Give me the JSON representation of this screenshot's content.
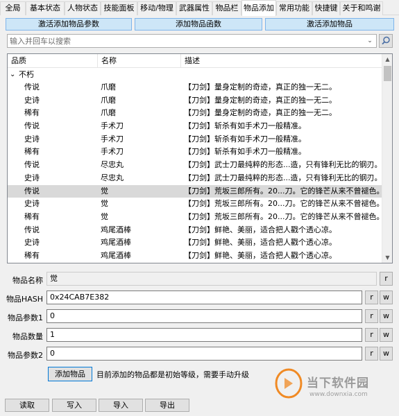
{
  "tabs": [
    {
      "label": "全局"
    },
    {
      "label": "基本状态"
    },
    {
      "label": "人物状态"
    },
    {
      "label": "技能面板"
    },
    {
      "label": "移动/物理"
    },
    {
      "label": "武器属性"
    },
    {
      "label": "物品栏"
    },
    {
      "label": "物品添加"
    },
    {
      "label": "常用功能"
    },
    {
      "label": "快捷键"
    },
    {
      "label": "关于和鸣谢"
    }
  ],
  "actions": {
    "activate_params": "激活添加物品参数",
    "add_function": "添加物品函数",
    "activate_add": "激活添加物品"
  },
  "search": {
    "placeholder": "输入并回车以搜索",
    "dropdown_glyph": "⌄"
  },
  "list": {
    "columns": {
      "quality": "品质",
      "name": "名称",
      "desc": "描述"
    },
    "group": {
      "expander": "⌄",
      "label": "不朽"
    },
    "rows": [
      {
        "quality": "传说",
        "name": "爪磨",
        "desc": "【刀剑】量身定制的奇迹，真正的独一无二。"
      },
      {
        "quality": "史诗",
        "name": "爪磨",
        "desc": "【刀剑】量身定制的奇迹，真正的独一无二。"
      },
      {
        "quality": "稀有",
        "name": "爪磨",
        "desc": "【刀剑】量身定制的奇迹，真正的独一无二。"
      },
      {
        "quality": "传说",
        "name": "手术刀",
        "desc": "【刀剑】斩杀有如手术刀一般精准。"
      },
      {
        "quality": "史诗",
        "name": "手术刀",
        "desc": "【刀剑】斩杀有如手术刀一般精准。"
      },
      {
        "quality": "稀有",
        "name": "手术刀",
        "desc": "【刀剑】斩杀有如手术刀一般精准。"
      },
      {
        "quality": "传说",
        "name": "尽忠丸",
        "desc": "【刀剑】武士刀最纯粹的形态...造，只有锋利无比的钢刃。"
      },
      {
        "quality": "史诗",
        "name": "尽忠丸",
        "desc": "【刀剑】武士刀最纯粹的形态...造，只有锋利无比的钢刃。"
      },
      {
        "quality": "传说",
        "name": "觉",
        "desc": "【刀剑】荒坂三郎所有。20...刀。它的锋芒从来不曾褪色。"
      },
      {
        "quality": "史诗",
        "name": "觉",
        "desc": "【刀剑】荒坂三郎所有。20...刀。它的锋芒从来不曾褪色。"
      },
      {
        "quality": "稀有",
        "name": "觉",
        "desc": "【刀剑】荒坂三郎所有。20...刀。它的锋芒从来不曾褪色。"
      },
      {
        "quality": "传说",
        "name": "鸡尾酒棒",
        "desc": "【刀剑】鲜艳、美丽，适合把人戳个透心凉。"
      },
      {
        "quality": "史诗",
        "name": "鸡尾酒棒",
        "desc": "【刀剑】鲜艳、美丽，适合把人戳个透心凉。"
      },
      {
        "quality": "稀有",
        "name": "鸡尾酒棒",
        "desc": "【刀剑】鲜艳、美丽，适合把人戳个透心凉。"
      }
    ],
    "selected_row": 8
  },
  "form": {
    "item_name": {
      "label": "物品名称",
      "value": "觉"
    },
    "item_hash": {
      "label": "物品HASH",
      "value": "0x24CAB7E382"
    },
    "param1": {
      "label": "物品参数1",
      "value": "0"
    },
    "quantity": {
      "label": "物品数量",
      "value": "1"
    },
    "param2": {
      "label": "物品参数2",
      "value": "0"
    },
    "read_btn": "r",
    "write_btn": "w"
  },
  "add_button": "添加物品",
  "add_note": "目前添加的物品都是初始等级，需要手动升级",
  "bottom": {
    "read": "读取",
    "write": "写入",
    "import": "导入",
    "export": "导出"
  },
  "watermark": {
    "text": "当下软件园",
    "url": "www.downxia.com"
  },
  "colors": {
    "accent_button": "#cde6f7",
    "accent_border": "#7eb4ea",
    "selected_row": "#d9d9d9",
    "focus_border": "#0078d7",
    "watermark_orange": "#f08a24"
  }
}
